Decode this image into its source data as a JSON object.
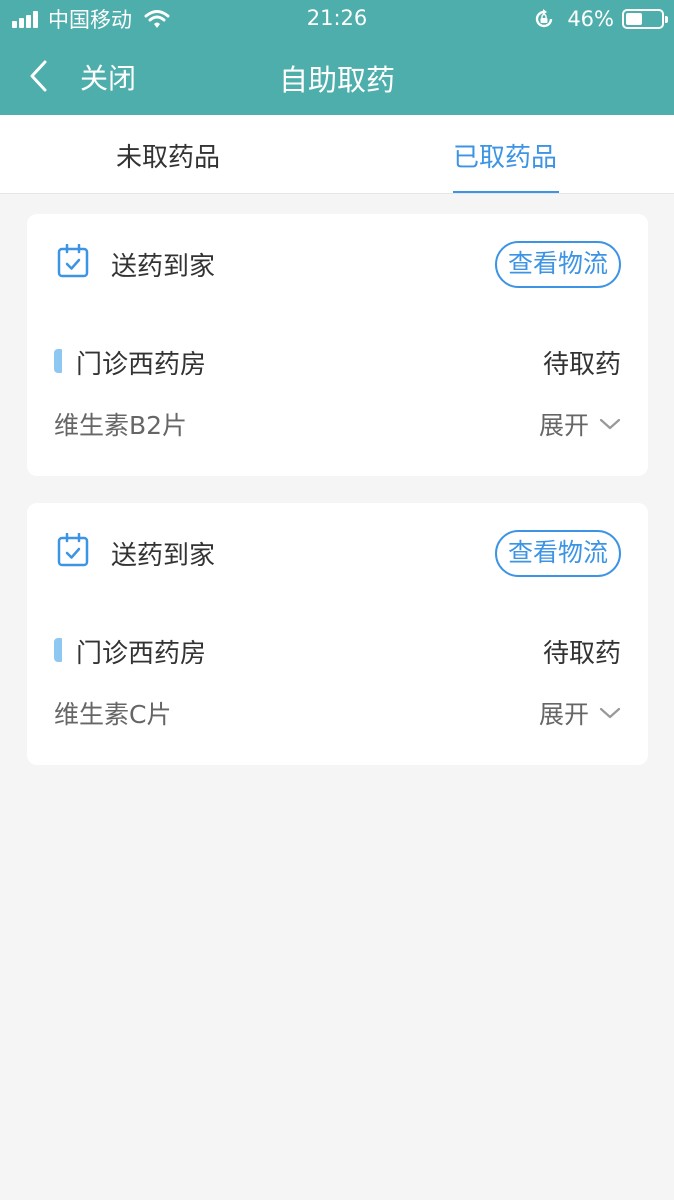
{
  "status_bar": {
    "carrier": "中国移动",
    "time": "21:26",
    "battery": "46%",
    "battery_level": 0.46
  },
  "nav": {
    "close_label": "关闭",
    "title": "自助取药"
  },
  "tabs": [
    {
      "label": "未取药品",
      "active": false
    },
    {
      "label": "已取药品",
      "active": true
    }
  ],
  "cards": [
    {
      "type": "送药到家",
      "logistics_button": "查看物流",
      "pharmacy": "门诊西药房",
      "status": "待取药",
      "drug": "维生素B2片",
      "expand_label": "展开"
    },
    {
      "type": "送药到家",
      "logistics_button": "查看物流",
      "pharmacy": "门诊西药房",
      "status": "待取药",
      "drug": "维生素C片",
      "expand_label": "展开"
    }
  ],
  "colors": {
    "header": "#4eaeab",
    "accent": "#3d94e4",
    "background": "#f5f5f5"
  }
}
